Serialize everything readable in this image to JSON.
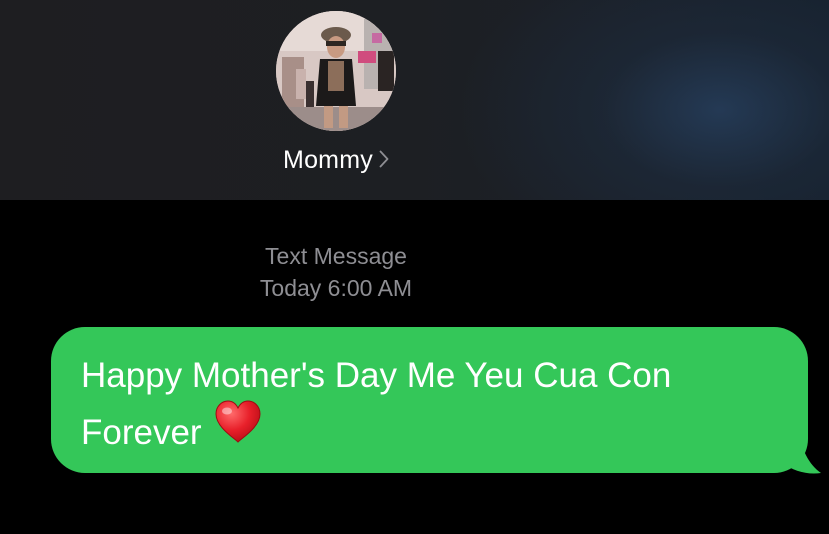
{
  "header": {
    "contact_name": "Mommy",
    "avatar_icon": "contact-photo",
    "chevron_icon": "chevron-right-icon"
  },
  "thread": {
    "service_label": "Text Message",
    "timestamp": "Today 6:00 AM"
  },
  "messages": [
    {
      "direction": "outgoing",
      "text_line_1": "Happy Mother's Day Me Yeu Cua Con",
      "text_line_2": "Forever",
      "emoji_icon": "red-heart-emoji",
      "bubble_color": "#34c759"
    }
  ],
  "colors": {
    "background": "#000000",
    "header_background": "#1e1e21",
    "meta_text": "#8e8e93",
    "bubble_text": "#ffffff"
  }
}
